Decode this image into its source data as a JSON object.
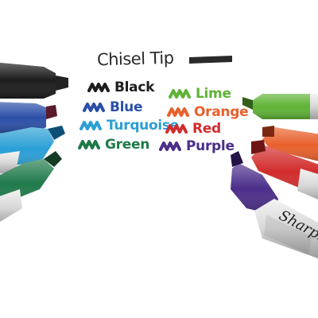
{
  "title": "Chisel Tip",
  "brand": "Sharpie",
  "colors": [
    {
      "name": "Black",
      "hex": "#1c1c1c"
    },
    {
      "name": "Lime",
      "hex": "#5fb336"
    },
    {
      "name": "Blue",
      "hex": "#2b4fa8"
    },
    {
      "name": "Orange",
      "hex": "#e8602c"
    },
    {
      "name": "Turquoise",
      "hex": "#2a9fd6"
    },
    {
      "name": "Red",
      "hex": "#d22c2c"
    },
    {
      "name": "Green",
      "hex": "#1f7a4a"
    },
    {
      "name": "Purple",
      "hex": "#4b2e8a"
    }
  ]
}
